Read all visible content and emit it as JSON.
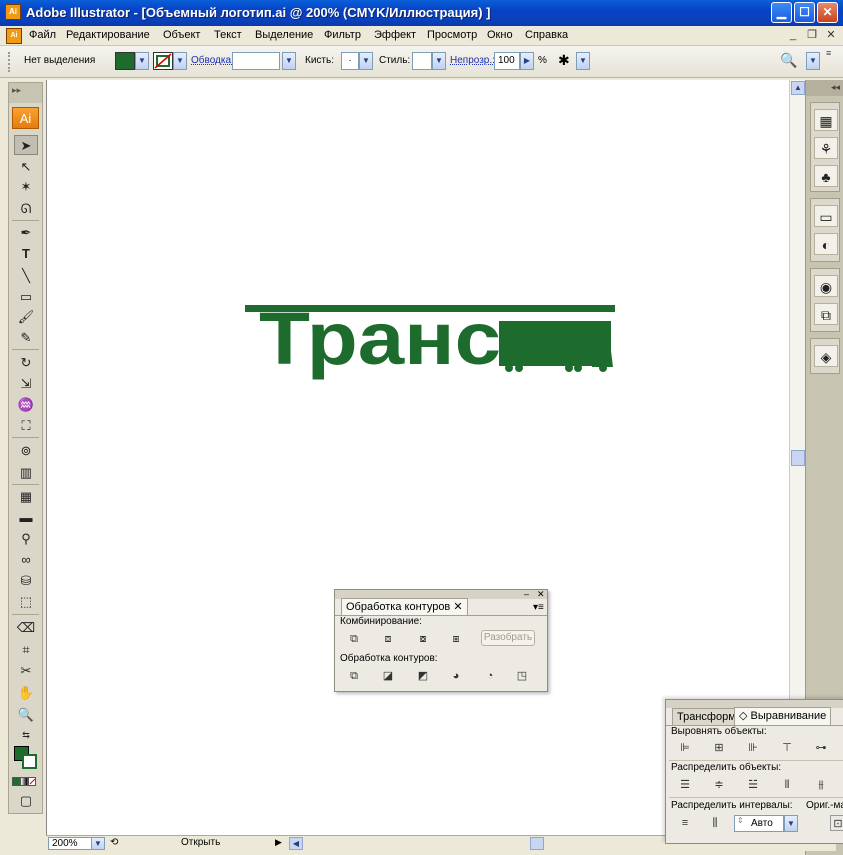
{
  "window": {
    "app_icon": "Ai",
    "title": "Adobe Illustrator - [Объемный логотип.ai @ 200% (CMYK/Иллюстрация) ]",
    "controls": [
      "minimize-icon",
      "maximize-icon",
      "close-icon"
    ]
  },
  "menu": {
    "doc_icon": "Ai",
    "items": [
      "Файл",
      "Редактирование",
      "Объект",
      "Текст",
      "Выделение",
      "Фильтр",
      "Эффект",
      "Просмотр",
      "Окно",
      "Справка"
    ]
  },
  "control_bar": {
    "selection_status": "Нет выделения",
    "fill_color": "#1e6b2e",
    "stroke_label": "Обводка:",
    "brush_label": "Кисть:",
    "brush_value": "·",
    "style_label": "Стиль:",
    "opacity_label": "Непрозр.:",
    "opacity_value": "100",
    "opacity_unit": "%"
  },
  "toolbox": {
    "logo": "Ai",
    "fill_color": "#1e6b2e"
  },
  "artwork": {
    "logo_text": "Транс",
    "color": "#1e6b2e"
  },
  "status_bar": {
    "zoom": "200%",
    "status_text": "Открыть"
  },
  "pathfinder_panel": {
    "tab_title": "Обработка контуров",
    "section_combine": "Комбинирование:",
    "expand_button": "Разобрать",
    "section_pathfinders": "Обработка контуров:"
  },
  "align_panel": {
    "tab_transform": "Трансформ",
    "tab_align": "Выравнивание",
    "section_align": "Выровнять объекты:",
    "section_distribute_objects": "Распределить объекты:",
    "section_distribute_spacing": "Распределить интервалы:",
    "section_align_to": "Ориг.-ма",
    "spacing_value": "Авто"
  }
}
